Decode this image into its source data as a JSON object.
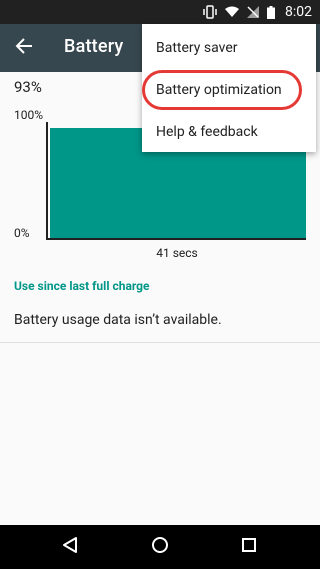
{
  "status_bar": {
    "time": "8:02"
  },
  "app_bar": {
    "title": "Battery"
  },
  "battery": {
    "percent_text": "93%",
    "graph_top_label": "100%",
    "graph_bottom_label": "0%",
    "duration_label": "41 secs",
    "level_fraction": 0.93
  },
  "usage": {
    "section_header": "Use since last full charge",
    "message": "Battery usage data isn’t available."
  },
  "overflow_menu": {
    "items": [
      {
        "label": "Battery saver"
      },
      {
        "label": "Battery optimization"
      },
      {
        "label": "Help & feedback"
      }
    ]
  },
  "colors": {
    "app_bar": "#37474f",
    "accent": "#009688",
    "highlight": "#e53935"
  }
}
